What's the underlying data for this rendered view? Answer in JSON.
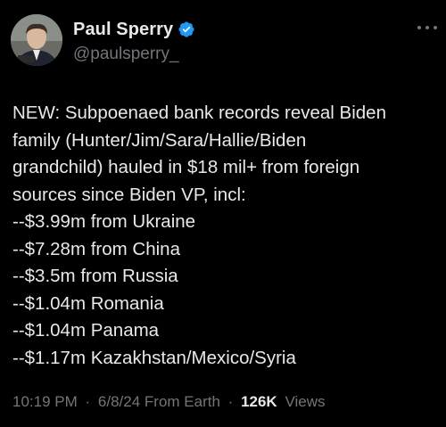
{
  "author": {
    "display_name": "Paul Sperry",
    "handle": "@paulsperry_",
    "verified_icon": "verified-badge-icon",
    "verified_color": "#1d9bf0"
  },
  "tweet": {
    "lines": [
      "NEW: Subpoenaed bank records reveal Biden",
      "family (Hunter/Jim/Sara/Hallie/Biden",
      "grandchild) hauled in $18 mil+ from foreign",
      "sources since Biden VP, incl:",
      "--$3.99m from Ukraine",
      "--$7.28m from China",
      "--$3.5m from Russia",
      "--$1.04m Romania",
      "--$1.04m Panama",
      "--$1.17m Kazakhstan/Mexico/Syria"
    ]
  },
  "meta": {
    "time": "10:19 PM",
    "separator": "·",
    "date_location": "6/8/24 From Earth",
    "views_count": "126K",
    "views_label": "Views"
  },
  "colors": {
    "background": "#000000",
    "text_primary": "#e7e9ea",
    "text_secondary": "#71767b"
  },
  "icons": {
    "more": "more-options-icon"
  }
}
